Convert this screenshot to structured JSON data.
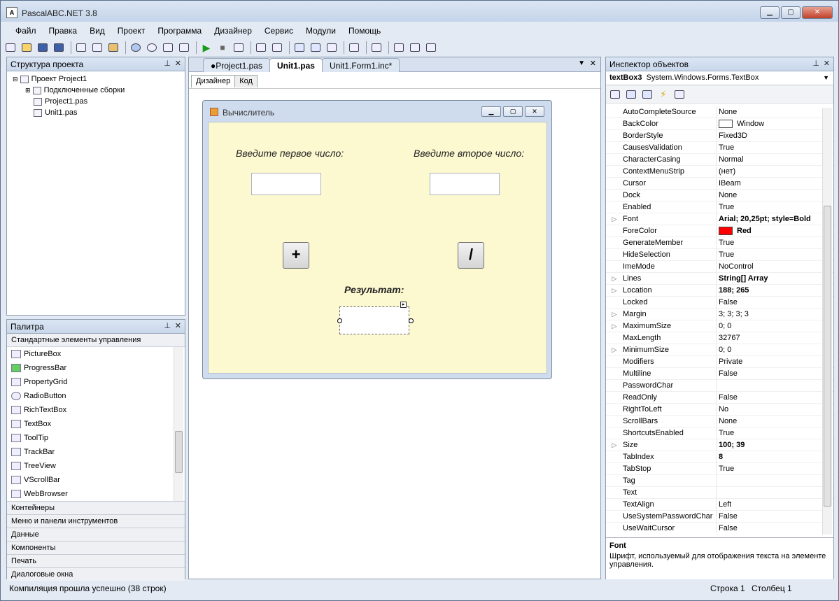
{
  "window": {
    "title": "PascalABC.NET 3.8",
    "min": "▁",
    "max": "▢",
    "close": "✕"
  },
  "menu": [
    "Файл",
    "Правка",
    "Вид",
    "Проект",
    "Программа",
    "Дизайнер",
    "Сервис",
    "Модули",
    "Помощь"
  ],
  "project_panel": {
    "title": "Структура проекта",
    "items": [
      "Проект Project1",
      "Подключенные сборки",
      "Project1.pas",
      "Unit1.pas"
    ]
  },
  "palette": {
    "title": "Палитра",
    "group": "Стандартные элементы управления",
    "items": [
      "PictureBox",
      "ProgressBar",
      "PropertyGrid",
      "RadioButton",
      "RichTextBox",
      "TextBox",
      "ToolTip",
      "TrackBar",
      "TreeView",
      "VScrollBar",
      "WebBrowser"
    ],
    "categories": [
      "Контейнеры",
      "Меню и панели инструментов",
      "Данные",
      "Компоненты",
      "Печать",
      "Диалоговые окна"
    ]
  },
  "editor": {
    "tabs": [
      "●Project1.pas",
      "Unit1.pas",
      "Unit1.Form1.inc*"
    ],
    "subtabs": [
      "Дизайнер",
      "Код"
    ]
  },
  "form": {
    "title": "Вычислитель",
    "label1": "Введите первое число:",
    "label2": "Введите второе число:",
    "btn_plus": "+",
    "btn_div": "/",
    "result_label": "Результат:"
  },
  "inspector": {
    "title": "Инспектор объектов",
    "object": "textBox3",
    "type": "System.Windows.Forms.TextBox",
    "props": [
      {
        "name": "AutoCompleteSource",
        "value": "None"
      },
      {
        "name": "BackColor",
        "value": "Window",
        "swatch": "#ffffff"
      },
      {
        "name": "BorderStyle",
        "value": "Fixed3D"
      },
      {
        "name": "CausesValidation",
        "value": "True"
      },
      {
        "name": "CharacterCasing",
        "value": "Normal"
      },
      {
        "name": "ContextMenuStrip",
        "value": "(нет)"
      },
      {
        "name": "Cursor",
        "value": "IBeam"
      },
      {
        "name": "Dock",
        "value": "None"
      },
      {
        "name": "Enabled",
        "value": "True"
      },
      {
        "name": "Font",
        "value": "Arial; 20,25pt; style=Bold",
        "bold": true,
        "exp": true
      },
      {
        "name": "ForeColor",
        "value": "Red",
        "bold": true,
        "swatch": "#ff0000"
      },
      {
        "name": "GenerateMember",
        "value": "True"
      },
      {
        "name": "HideSelection",
        "value": "True"
      },
      {
        "name": "ImeMode",
        "value": "NoControl"
      },
      {
        "name": "Lines",
        "value": "String[] Array",
        "bold": true,
        "exp": true
      },
      {
        "name": "Location",
        "value": "188; 265",
        "bold": true,
        "exp": true
      },
      {
        "name": "Locked",
        "value": "False"
      },
      {
        "name": "Margin",
        "value": "3; 3; 3; 3",
        "exp": true
      },
      {
        "name": "MaximumSize",
        "value": "0; 0",
        "exp": true
      },
      {
        "name": "MaxLength",
        "value": "32767"
      },
      {
        "name": "MinimumSize",
        "value": "0; 0",
        "exp": true
      },
      {
        "name": "Modifiers",
        "value": "Private"
      },
      {
        "name": "Multiline",
        "value": "False"
      },
      {
        "name": "PasswordChar",
        "value": ""
      },
      {
        "name": "ReadOnly",
        "value": "False"
      },
      {
        "name": "RightToLeft",
        "value": "No"
      },
      {
        "name": "ScrollBars",
        "value": "None"
      },
      {
        "name": "ShortcutsEnabled",
        "value": "True"
      },
      {
        "name": "Size",
        "value": "100; 39",
        "bold": true,
        "exp": true
      },
      {
        "name": "TabIndex",
        "value": "8",
        "bold": true
      },
      {
        "name": "TabStop",
        "value": "True"
      },
      {
        "name": "Tag",
        "value": ""
      },
      {
        "name": "Text",
        "value": ""
      },
      {
        "name": "TextAlign",
        "value": "Left"
      },
      {
        "name": "UseSystemPasswordChar",
        "value": "False"
      },
      {
        "name": "UseWaitCursor",
        "value": "False"
      }
    ],
    "desc_title": "Font",
    "desc_text": "Шрифт, используемый для отображения текста на элементе управления."
  },
  "status": {
    "message": "Компиляция прошла успешно (38 строк)",
    "row": "Строка  1",
    "col": "Столбец  1"
  }
}
